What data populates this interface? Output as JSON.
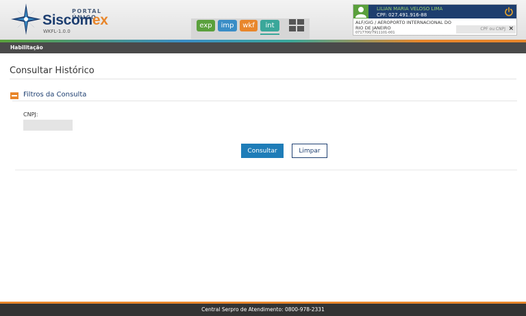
{
  "header": {
    "logo": {
      "portal_label": "PORTAL ÚNICO",
      "title_main": "Siscom",
      "title_accent": "ex",
      "version": "WKFL-1.0.0"
    },
    "modules": [
      {
        "label": "exp",
        "color": "#5aa03c"
      },
      {
        "label": "imp",
        "color": "#3a8dc6"
      },
      {
        "label": "wkf",
        "color": "#e8862b"
      },
      {
        "label": "int",
        "color": "#3aa79a",
        "active": true
      }
    ],
    "apps_icon": "grid-icon",
    "user": {
      "name": "LILIAN MARIA VELOSO LIMA",
      "cpf": "CPF: 027.491.916-88",
      "org": "ALF/GIG / AEROPORTO INTERNACIONAL DO RIO DE JANEIRO",
      "code": "0717700/7911101-001",
      "search_placeholder": "CPF ou CNPJ",
      "close_symbol": "×",
      "avatar_icon": "user-icon",
      "power_icon": "power-icon"
    }
  },
  "nav": {
    "items": [
      {
        "label": "Habilitação"
      }
    ]
  },
  "main": {
    "title": "Consultar Histórico",
    "section": {
      "title": "Filtros da Consulta",
      "collapse_icon": "minus-icon"
    },
    "fields": {
      "cnpj_label": "CNPJ:",
      "cnpj_value": ""
    },
    "buttons": {
      "consultar": "Consultar",
      "limpar": "Limpar"
    }
  },
  "footer": {
    "text": "Central Serpro de Atendimento: 0800-978-2331"
  },
  "colors": {
    "brand_navy": "#1d3e70",
    "accent_orange": "#e8862b",
    "primary_button": "#1f7db8"
  }
}
